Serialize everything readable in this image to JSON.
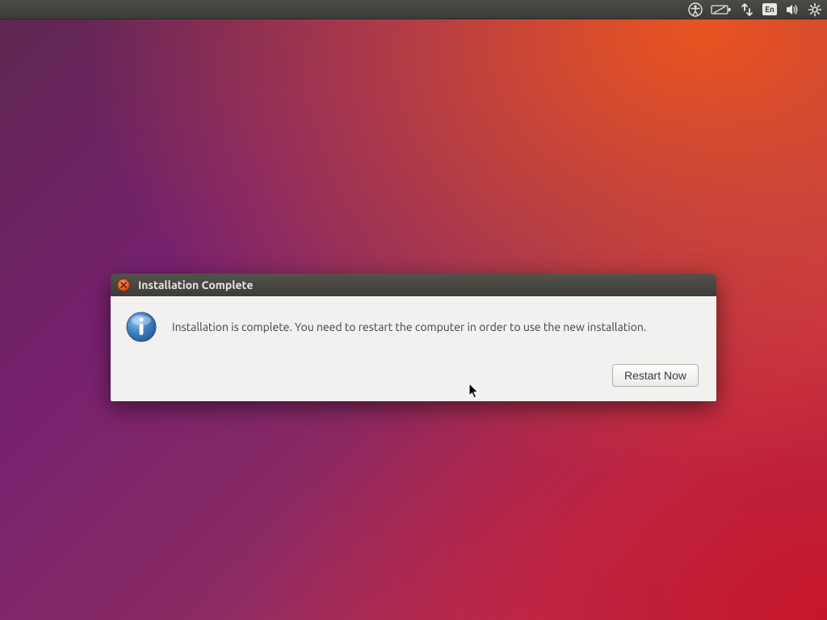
{
  "menubar": {
    "language": "En"
  },
  "dialog": {
    "title": "Installation Complete",
    "message": "Installation is complete. You need to restart the computer in order to use the new installation.",
    "restart_label": "Restart Now"
  }
}
